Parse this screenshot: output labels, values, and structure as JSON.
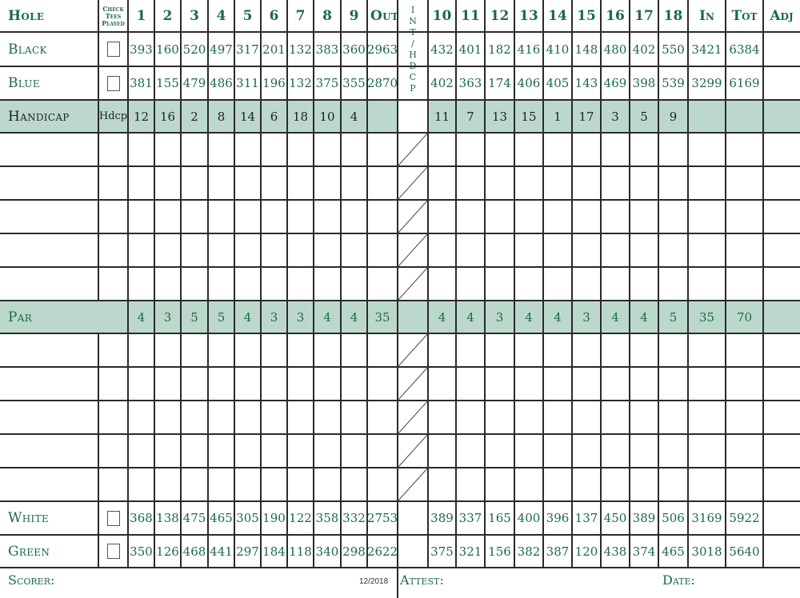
{
  "header": {
    "hole_label": "Hole",
    "check_tees_label": [
      "Check",
      "Tees",
      "Played"
    ],
    "front_holes": [
      "1",
      "2",
      "3",
      "4",
      "5",
      "6",
      "7",
      "8",
      "9"
    ],
    "out_label": "Out",
    "int_hdcp_label": [
      "I",
      "N",
      "T",
      "/",
      "H",
      "D",
      "C",
      "P"
    ],
    "back_holes": [
      "10",
      "11",
      "12",
      "13",
      "14",
      "15",
      "16",
      "17",
      "18"
    ],
    "in_label": "In",
    "tot_label": "Tot",
    "adj_label": "Adj"
  },
  "tees": [
    {
      "name": "Black",
      "front": [
        "393",
        "160",
        "520",
        "497",
        "317",
        "201",
        "132",
        "383",
        "360"
      ],
      "out": "2963",
      "back": [
        "432",
        "401",
        "182",
        "416",
        "410",
        "148",
        "480",
        "402",
        "550"
      ],
      "in": "3421",
      "tot": "6384"
    },
    {
      "name": "Blue",
      "front": [
        "381",
        "155",
        "479",
        "486",
        "311",
        "196",
        "132",
        "375",
        "355"
      ],
      "out": "2870",
      "back": [
        "402",
        "363",
        "174",
        "406",
        "405",
        "143",
        "469",
        "398",
        "539"
      ],
      "in": "3299",
      "tot": "6169"
    }
  ],
  "handicap": {
    "name": "Handicap",
    "tag": "Hdcp",
    "front": [
      "12",
      "16",
      "2",
      "8",
      "14",
      "6",
      "18",
      "10",
      "4"
    ],
    "back": [
      "11",
      "7",
      "13",
      "15",
      "1",
      "17",
      "3",
      "5",
      "9"
    ]
  },
  "par": {
    "name": "Par",
    "front": [
      "4",
      "3",
      "5",
      "5",
      "4",
      "3",
      "3",
      "4",
      "4"
    ],
    "out": "35",
    "back": [
      "4",
      "4",
      "3",
      "4",
      "4",
      "3",
      "4",
      "4",
      "5"
    ],
    "in": "35",
    "tot": "70"
  },
  "tees_bottom": [
    {
      "name": "White",
      "front": [
        "368",
        "138",
        "475",
        "465",
        "305",
        "190",
        "122",
        "358",
        "332"
      ],
      "out": "2753",
      "back": [
        "389",
        "337",
        "165",
        "400",
        "396",
        "137",
        "450",
        "389",
        "506"
      ],
      "in": "3169",
      "tot": "5922"
    },
    {
      "name": "Green",
      "front": [
        "350",
        "126",
        "468",
        "441",
        "297",
        "184",
        "118",
        "340",
        "298"
      ],
      "out": "2622",
      "back": [
        "375",
        "321",
        "156",
        "382",
        "387",
        "120",
        "438",
        "374",
        "465"
      ],
      "in": "3018",
      "tot": "5640"
    }
  ],
  "footer": {
    "scorer_label": "Scorer:",
    "version": "12/2018",
    "attest_label": "Attest:",
    "date_label": "Date:"
  },
  "colors": {
    "text_green": "#1b6b43",
    "shade": "#bcd8cc",
    "line": "#2a2a2a"
  }
}
